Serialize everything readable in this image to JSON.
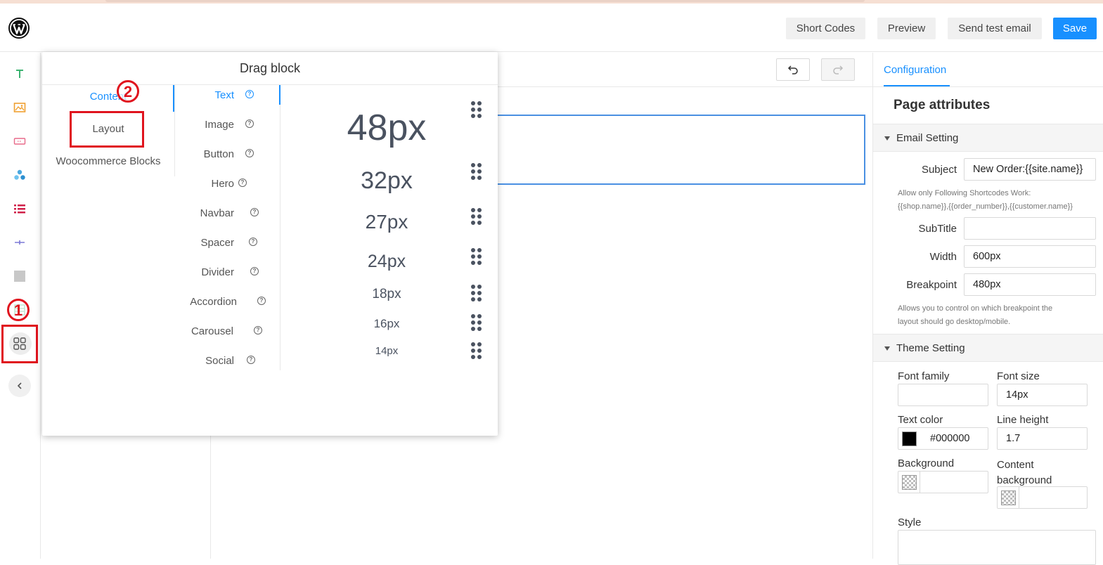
{
  "header": {
    "buttons": {
      "short_codes": "Short Codes",
      "preview": "Preview",
      "send_test": "Send test email",
      "save": "Save"
    }
  },
  "rail": {
    "icons": [
      "text-icon",
      "image-icon",
      "button-icon",
      "hero-icon",
      "list-icon",
      "spacer-icon",
      "block-icon",
      "columns-icon",
      "grid-icon",
      "chevron-left-icon"
    ],
    "annotation_1": "1"
  },
  "drag_block": {
    "title": "Drag block",
    "annotation_2": "2",
    "categories": [
      "Content",
      "Layout",
      "Woocommerce Blocks"
    ],
    "active_category": "Content",
    "blocks": [
      "Text",
      "Image",
      "Button",
      "Hero",
      "Navbar",
      "Spacer",
      "Divider",
      "Accordion",
      "Carousel",
      "Social"
    ],
    "active_block": "Text",
    "samples": [
      "48px",
      "32px",
      "27px",
      "24px",
      "18px",
      "16px",
      "14px"
    ],
    "help_glyph": "?"
  },
  "panel": {
    "tab": "Configuration",
    "page_attributes": "Page attributes",
    "email_setting": {
      "title": "Email Setting",
      "subject_label": "Subject",
      "subject_value": "New Order:{{site.name}}",
      "shortcode_hint_1": "Allow only Following Shortcodes Work:",
      "shortcode_hint_2": "{{shop.name}},{{order_number}},{{customer.name}}",
      "subtitle_label": "SubTitle",
      "subtitle_value": "",
      "width_label": "Width",
      "width_value": "600px",
      "breakpoint_label": "Breakpoint",
      "breakpoint_value": "480px",
      "breakpoint_hint_1": "Allows you to control on which breakpoint the",
      "breakpoint_hint_2": "layout should go desktop/mobile."
    },
    "theme_setting": {
      "title": "Theme Setting",
      "font_family_label": "Font family",
      "font_family_value": "",
      "font_size_label": "Font size",
      "font_size_value": "14px",
      "text_color_label": "Text color",
      "text_color_value": "#000000",
      "line_height_label": "Line height",
      "line_height_value": "1.7",
      "background_label": "Background",
      "background_value": "",
      "content_background_label_1": "Content",
      "content_background_label_2": "background",
      "content_background_value": "",
      "style_label": "Style"
    }
  },
  "colors": {
    "accent": "#1890ff",
    "annotation": "#e0141e",
    "text_color_swatch": "#000000"
  }
}
